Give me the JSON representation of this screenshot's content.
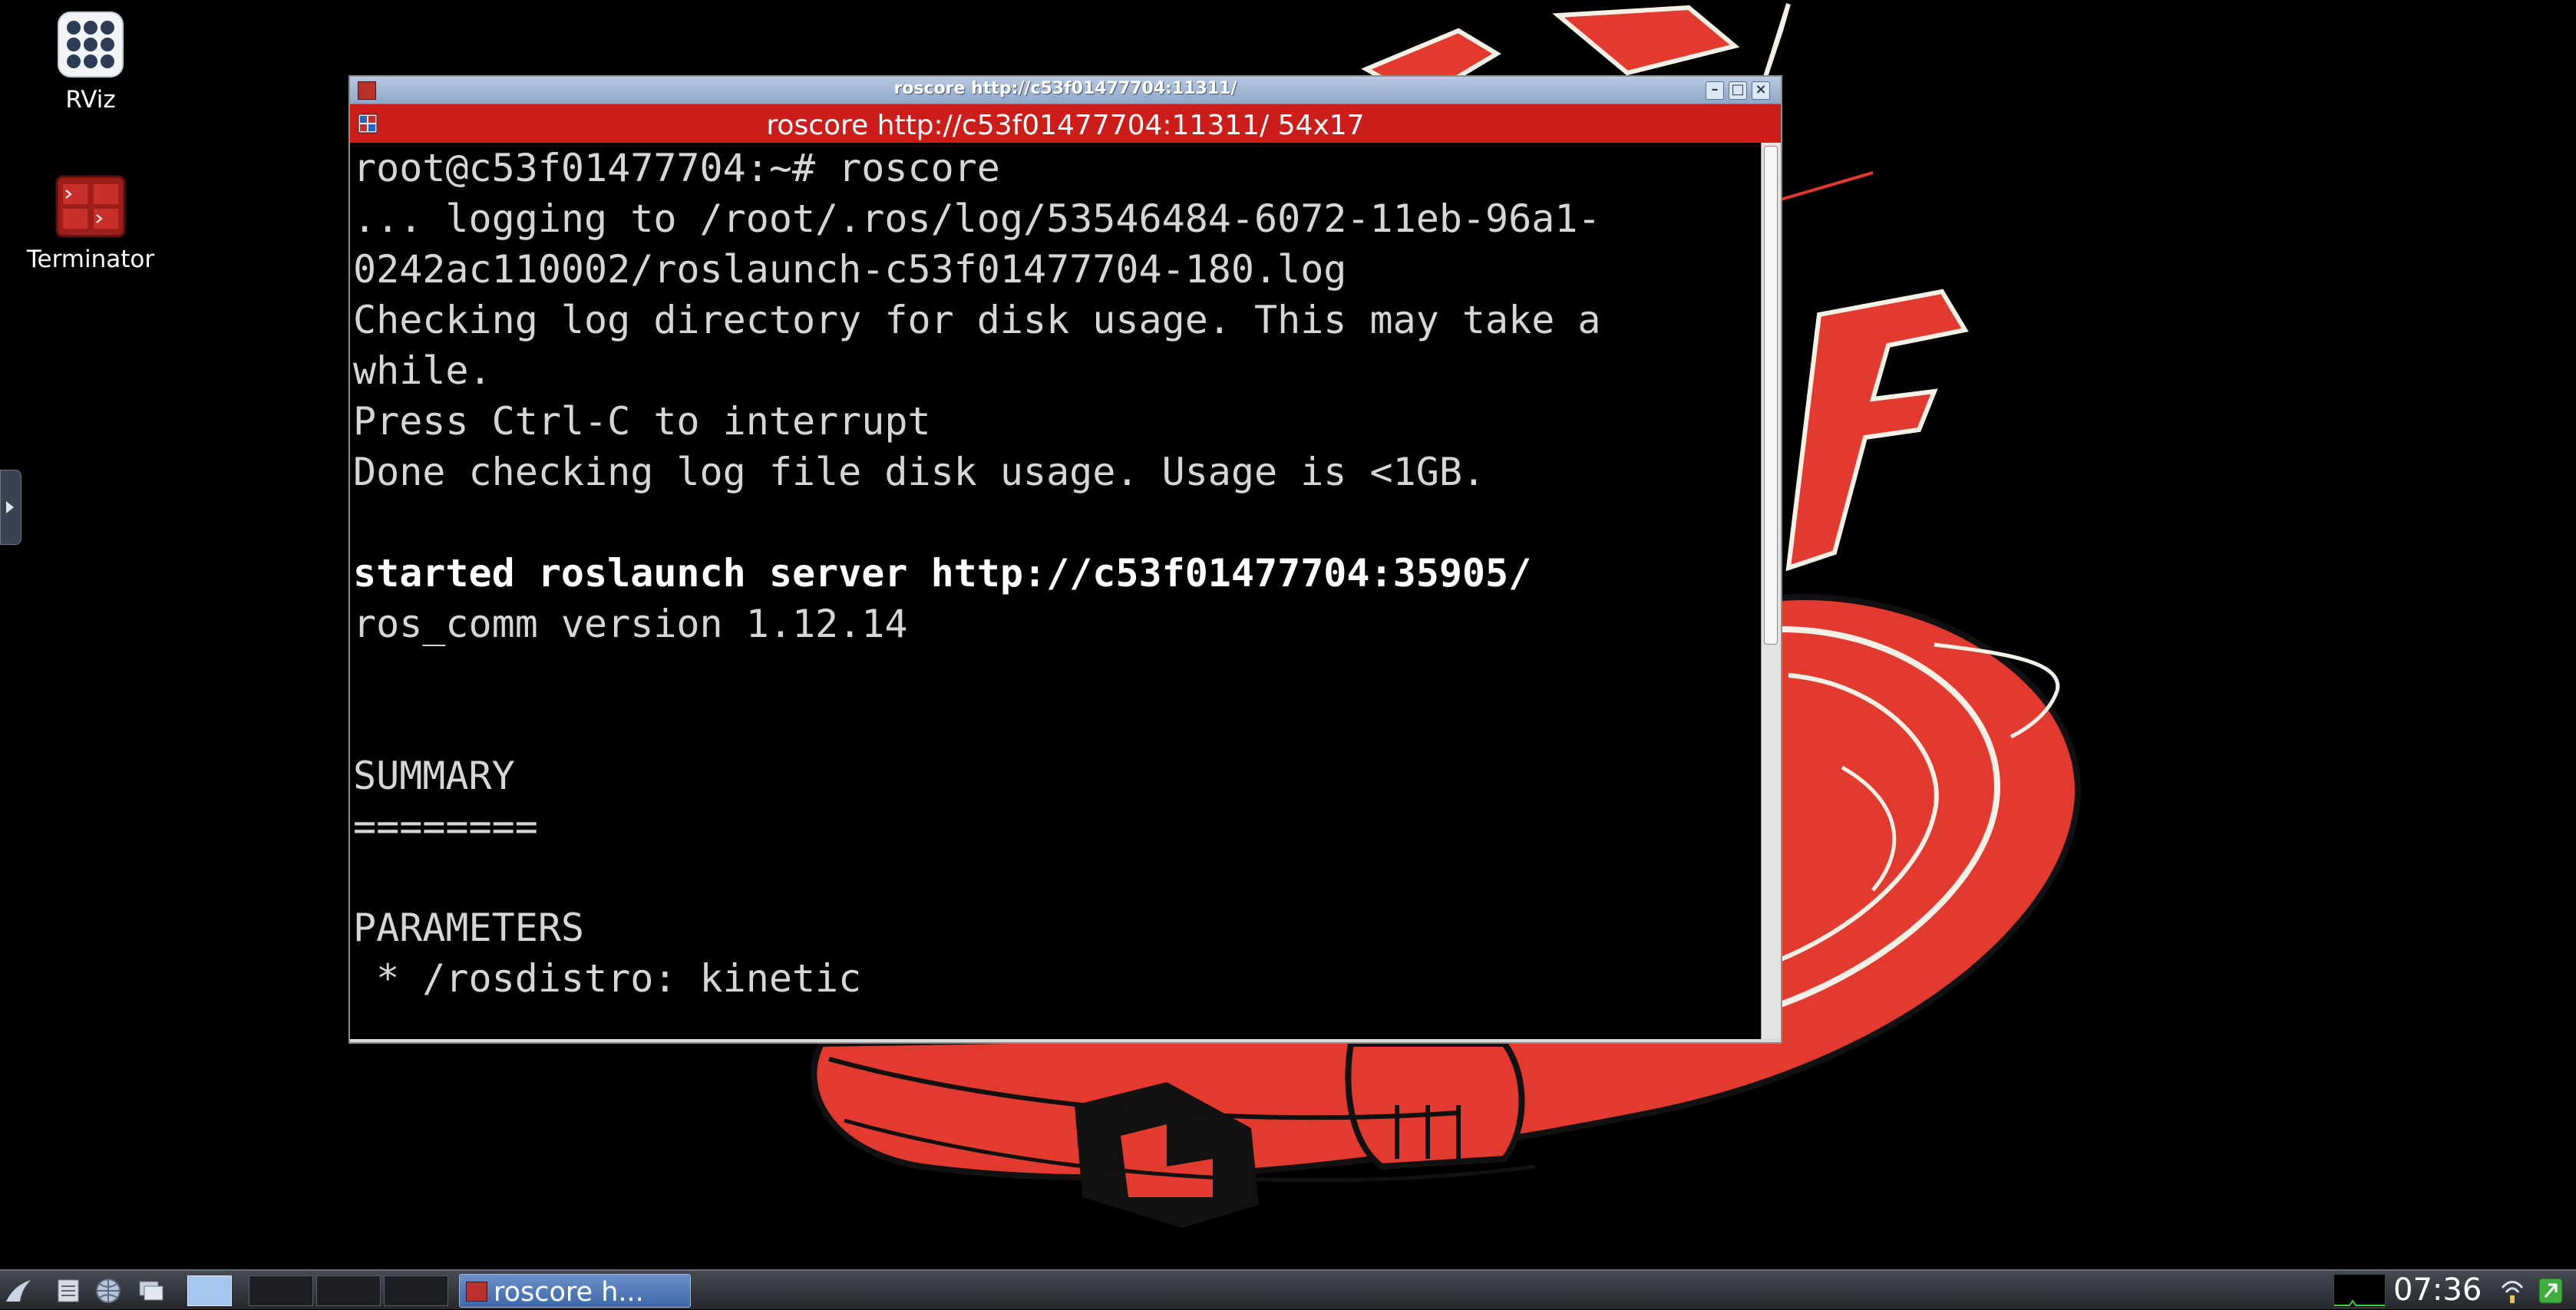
{
  "desktop": {
    "icons": [
      {
        "label": "RViz",
        "icon": "grid-dots-icon"
      },
      {
        "label": "Terminator",
        "icon": "terminator-icon"
      }
    ]
  },
  "window": {
    "title": "roscore http://c53f01477704:11311/",
    "terminal_title": "roscore http://c53f01477704:11311/ 54x17",
    "lines": [
      {
        "text": "root@c53f01477704:~# roscore",
        "bold": false
      },
      {
        "text": "... logging to /root/.ros/log/53546484-6072-11eb-96a1-",
        "bold": false
      },
      {
        "text": "0242ac110002/roslaunch-c53f01477704-180.log",
        "bold": false
      },
      {
        "text": "Checking log directory for disk usage. This may take a",
        "bold": false
      },
      {
        "text": "while.",
        "bold": false
      },
      {
        "text": "Press Ctrl-C to interrupt",
        "bold": false
      },
      {
        "text": "Done checking log file disk usage. Usage is <1GB.",
        "bold": false
      },
      {
        "text": "",
        "bold": false
      },
      {
        "text": "started roslaunch server http://c53f01477704:35905/",
        "bold": true
      },
      {
        "text": "ros_comm version 1.12.14",
        "bold": false
      },
      {
        "text": "",
        "bold": false
      },
      {
        "text": "",
        "bold": false
      },
      {
        "text": "SUMMARY",
        "bold": false
      },
      {
        "text": "========",
        "bold": false
      },
      {
        "text": "",
        "bold": false
      },
      {
        "text": "PARAMETERS",
        "bold": false
      },
      {
        "text": " * /rosdistro: kinetic",
        "bold": false
      }
    ]
  },
  "taskbar": {
    "task_label": "roscore h...",
    "clock": "07:36"
  },
  "colors": {
    "terminal_bg": "#000000",
    "terminal_fg": "#d6d6d6",
    "terminator_bar": "#cc1d1a",
    "wallpaper_red": "#e23a2e"
  }
}
